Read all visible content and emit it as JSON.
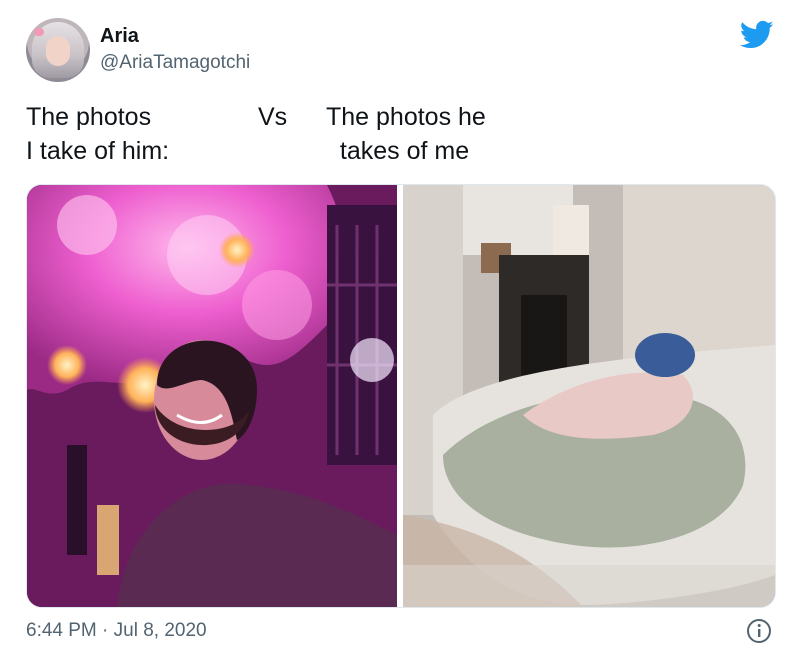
{
  "tweet": {
    "author": {
      "display_name": "Aria",
      "handle": "@AriaTamagotchi",
      "avatar_icon": "profile-photo"
    },
    "text": {
      "left": "The photos\nI take of him:",
      "middle": "Vs",
      "right": "The photos he\n  takes of me"
    },
    "media": {
      "left_photo": "photo-man-under-pink-blossom-ceiling",
      "right_photo": "photo-blurry-bedroom"
    },
    "timestamp": "6:44 PM · Jul 8, 2020",
    "brand_icon": "twitter-bird-icon",
    "info_icon": "info-icon",
    "colors": {
      "twitter_blue": "#1d9bf0",
      "text_primary": "#0f1419",
      "text_secondary": "#536471"
    }
  }
}
